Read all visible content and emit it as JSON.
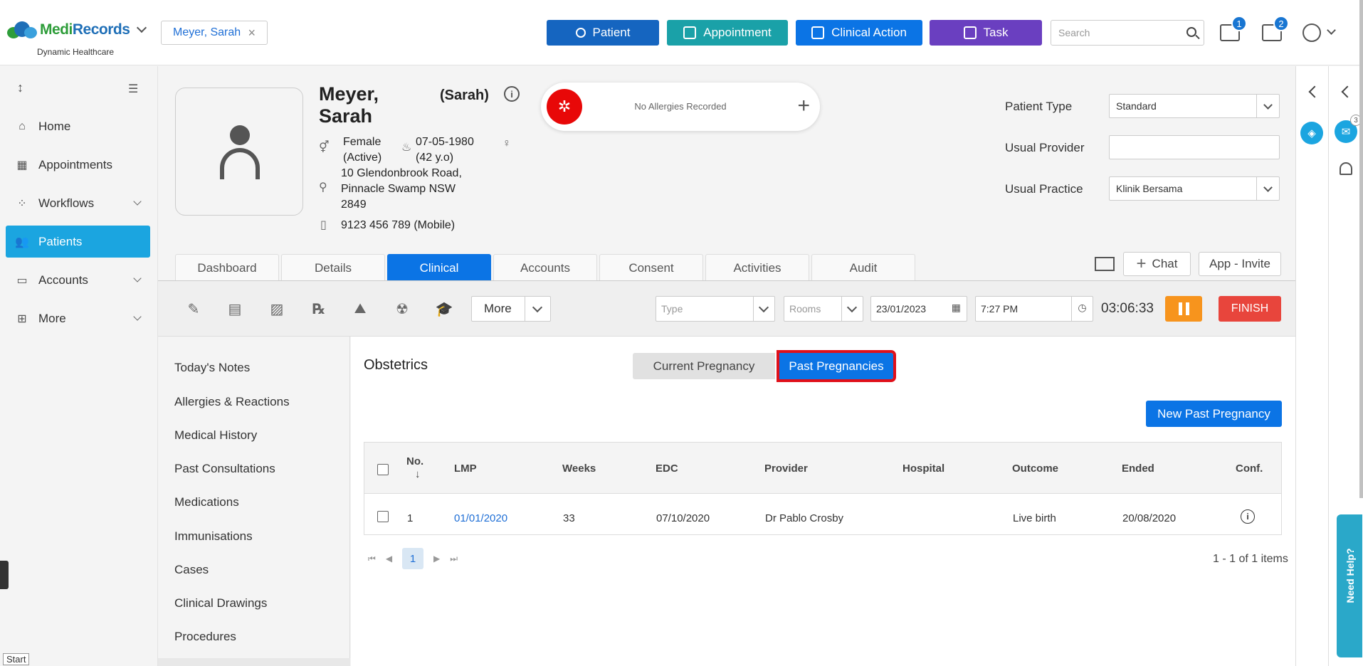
{
  "app": {
    "brand_part1": "Medi",
    "brand_part2": "Records",
    "subtitle": "Dynamic Healthcare",
    "patient_chip": "Meyer, Sarah"
  },
  "top_actions": {
    "patient": "Patient",
    "appointment": "Appointment",
    "clinical_action": "Clinical Action",
    "task": "Task",
    "search_placeholder": "Search",
    "mail_badge": "1",
    "calendar_badge": "2"
  },
  "sidebar": {
    "items": [
      {
        "label": "Home",
        "icon": "home-icon"
      },
      {
        "label": "Appointments",
        "icon": "calendar-icon"
      },
      {
        "label": "Workflows",
        "icon": "workflow-icon"
      },
      {
        "label": "Patients",
        "icon": "users-icon"
      },
      {
        "label": "Accounts",
        "icon": "folder-icon"
      },
      {
        "label": "More",
        "icon": "more-icon"
      }
    ],
    "start_label": "Start"
  },
  "patient": {
    "surname": "Meyer,",
    "firstname": "Sarah",
    "nickname": "(Sarah)",
    "gender": "Female",
    "status": "(Active)",
    "dob": "07-05-1980",
    "age": "(42 y.o)",
    "address_line1": "10 Glendonbrook Road,",
    "address_line2": "Pinnacle Swamp NSW",
    "address_line3": "2849",
    "phone": "9123 456 789 (Mobile)",
    "allergy_text": "No Allergies Recorded"
  },
  "fields": {
    "patient_type_label": "Patient Type",
    "patient_type_value": "Standard",
    "usual_provider_label": "Usual Provider",
    "usual_provider_value": "",
    "usual_practice_label": "Usual Practice",
    "usual_practice_value": "Klinik Bersama"
  },
  "tabs": [
    "Dashboard",
    "Details",
    "Clinical",
    "Accounts",
    "Consent",
    "Activities",
    "Audit"
  ],
  "tab_actions": {
    "chat": "Chat",
    "invite": "App - Invite"
  },
  "toolbar": {
    "more": "More",
    "type_placeholder": "Type",
    "rooms_placeholder": "Rooms",
    "date": "23/01/2023",
    "time": "7:27 PM",
    "timer": "03:06:33",
    "finish": "FINISH"
  },
  "clinical_nav": [
    "Today's Notes",
    "Allergies & Reactions",
    "Medical History",
    "Past Consultations",
    "Medications",
    "Immunisations",
    "Cases",
    "Clinical Drawings",
    "Procedures"
  ],
  "obstetrics": {
    "title": "Obstetrics",
    "current_tab": "Current Pregnancy",
    "past_tab": "Past Pregnancies",
    "new_button": "New Past Pregnancy",
    "columns": {
      "no": "No.",
      "sort_arrow": "↓",
      "lmp": "LMP",
      "weeks": "Weeks",
      "edc": "EDC",
      "provider": "Provider",
      "hospital": "Hospital",
      "outcome": "Outcome",
      "ended": "Ended",
      "conf": "Conf."
    },
    "rows": [
      {
        "no": "1",
        "lmp": "01/01/2020",
        "weeks": "33",
        "edc": "07/10/2020",
        "provider": "Dr Pablo Crosby",
        "hospital": "",
        "outcome": "Live birth",
        "ended": "20/08/2020"
      }
    ],
    "page": "1",
    "summary": "1 - 1 of 1 items"
  },
  "right_rail": {
    "chat_badge": "3",
    "help": "Need Help?"
  },
  "colors": {
    "primary_blue": "#0b74e5",
    "active_nav": "#1ba5e0",
    "highlight_red": "#e0101a",
    "finish_red": "#e8453c",
    "pause_orange": "#f7941d"
  }
}
